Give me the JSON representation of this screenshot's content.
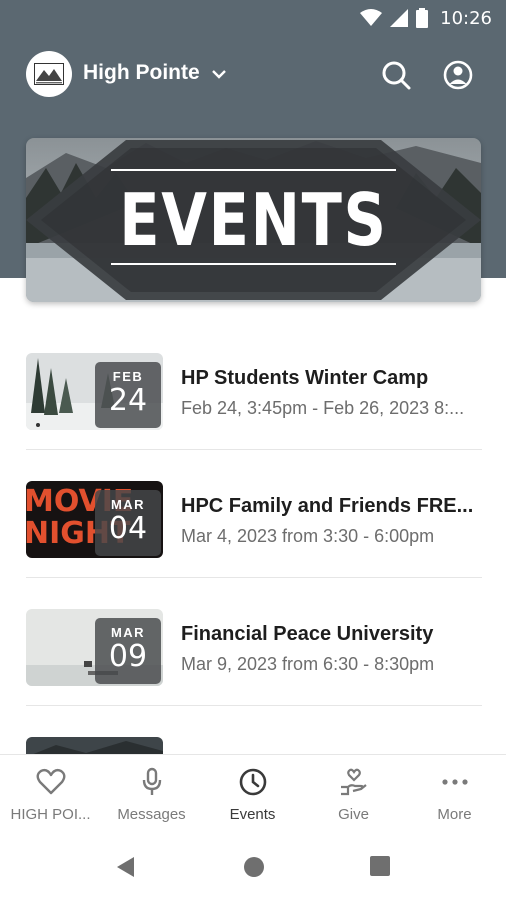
{
  "status_bar": {
    "time": "10:26",
    "icons": [
      "wifi-icon",
      "cell-signal-icon",
      "battery-icon"
    ]
  },
  "app_bar": {
    "org_name": "High Pointe",
    "icons": [
      "org-logo",
      "chevron-down-icon",
      "search-icon",
      "profile-icon"
    ]
  },
  "banner": {
    "title": "EVENTS"
  },
  "events": [
    {
      "month": "FEB",
      "day": "24",
      "title": "HP Students Winter Camp",
      "time": "Feb 24, 3:45pm - Feb 26, 2023 8:..."
    },
    {
      "month": "MAR",
      "day": "04",
      "title": "HPC Family and Friends FRE...",
      "time": "Mar 4, 2023 from 3:30 - 6:00pm",
      "thumb_text_1": "MOVIE",
      "thumb_text_2": "NIGHT"
    },
    {
      "month": "MAR",
      "day": "09",
      "title": "Financial Peace University",
      "time": "Mar 9, 2023 from 6:30 - 8:30pm"
    }
  ],
  "tabs": [
    {
      "label": "HIGH POI...",
      "icon": "heart-icon"
    },
    {
      "label": "Messages",
      "icon": "microphone-icon"
    },
    {
      "label": "Events",
      "icon": "clock-icon",
      "active": true
    },
    {
      "label": "Give",
      "icon": "give-hand-icon"
    },
    {
      "label": "More",
      "icon": "more-dots-icon"
    }
  ],
  "nav_bar": {
    "icons": [
      "back-icon",
      "home-icon",
      "recents-icon"
    ]
  },
  "colors": {
    "header": "#5b6871",
    "badge": "#46484a",
    "tab_inactive": "#7a7a7a",
    "tab_active": "#3a3a3a"
  }
}
